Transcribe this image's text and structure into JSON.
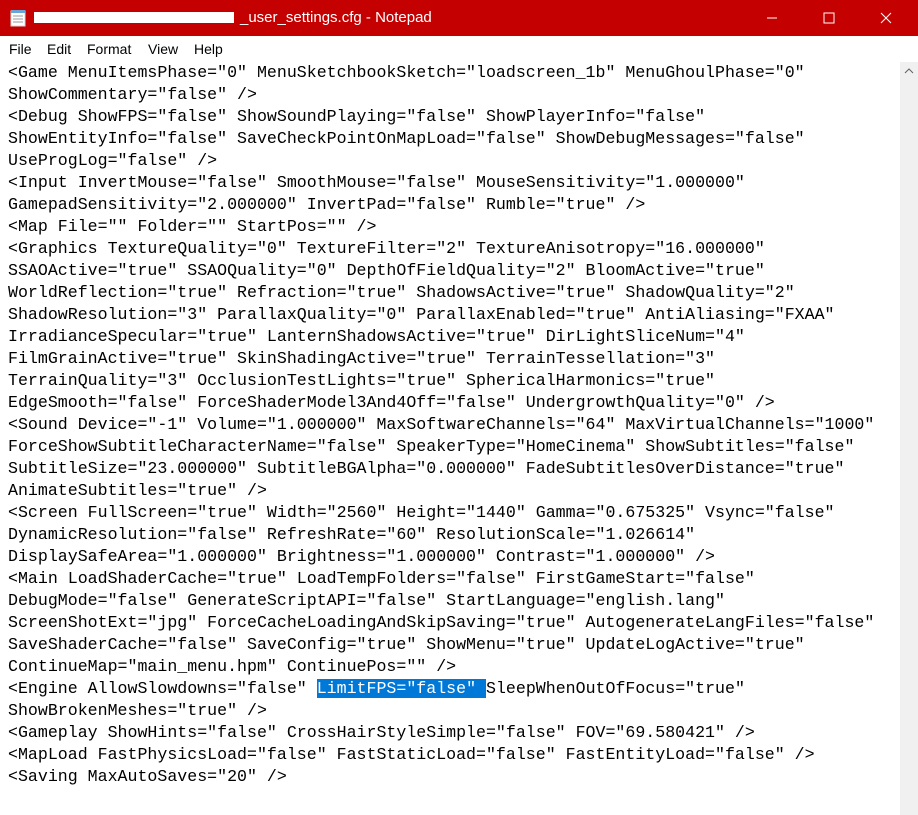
{
  "window": {
    "title": "_user_settings.cfg - Notepad",
    "minimize_glyph": "—",
    "maximize_glyph": "☐",
    "close_glyph": "✕"
  },
  "menu": {
    "file": "File",
    "edit": "Edit",
    "format": "Format",
    "view": "View",
    "help": "Help"
  },
  "lines": [
    "<Game MenuItemsPhase=\"0\" MenuSketchbookSketch=\"loadscreen_1b\" MenuGhoulPhase=\"0\"",
    "ShowCommentary=\"false\" />",
    "<Debug ShowFPS=\"false\" ShowSoundPlaying=\"false\" ShowPlayerInfo=\"false\"",
    "ShowEntityInfo=\"false\" SaveCheckPointOnMapLoad=\"false\" ShowDebugMessages=\"false\"",
    "UseProgLog=\"false\" />",
    "<Input InvertMouse=\"false\" SmoothMouse=\"false\" MouseSensitivity=\"1.000000\"",
    "GamepadSensitivity=\"2.000000\" InvertPad=\"false\" Rumble=\"true\" />",
    "<Map File=\"\" Folder=\"\" StartPos=\"\" />",
    "<Graphics TextureQuality=\"0\" TextureFilter=\"2\" TextureAnisotropy=\"16.000000\"",
    "SSAOActive=\"true\" SSAOQuality=\"0\" DepthOfFieldQuality=\"2\" BloomActive=\"true\"",
    "WorldReflection=\"true\" Refraction=\"true\" ShadowsActive=\"true\" ShadowQuality=\"2\"",
    "ShadowResolution=\"3\" ParallaxQuality=\"0\" ParallaxEnabled=\"true\" AntiAliasing=\"FXAA\"",
    "IrradianceSpecular=\"true\" LanternShadowsActive=\"true\" DirLightSliceNum=\"4\"",
    "FilmGrainActive=\"true\" SkinShadingActive=\"true\" TerrainTessellation=\"3\"",
    "TerrainQuality=\"3\" OcclusionTestLights=\"true\" SphericalHarmonics=\"true\"",
    "EdgeSmooth=\"false\" ForceShaderModel3And4Off=\"false\" UndergrowthQuality=\"0\" />",
    "<Sound Device=\"-1\" Volume=\"1.000000\" MaxSoftwareChannels=\"64\" MaxVirtualChannels=\"1000\"",
    "ForceShowSubtitleCharacterName=\"false\" SpeakerType=\"HomeCinema\" ShowSubtitles=\"false\"",
    "SubtitleSize=\"23.000000\" SubtitleBGAlpha=\"0.000000\" FadeSubtitlesOverDistance=\"true\"",
    "AnimateSubtitles=\"true\" />",
    "<Screen FullScreen=\"true\" Width=\"2560\" Height=\"1440\" Gamma=\"0.675325\" Vsync=\"false\"",
    "DynamicResolution=\"false\" RefreshRate=\"60\" ResolutionScale=\"1.026614\"",
    "DisplaySafeArea=\"1.000000\" Brightness=\"1.000000\" Contrast=\"1.000000\" />",
    "<Main LoadShaderCache=\"true\" LoadTempFolders=\"false\" FirstGameStart=\"false\"",
    "DebugMode=\"false\" GenerateScriptAPI=\"false\" StartLanguage=\"english.lang\"",
    "ScreenShotExt=\"jpg\" ForceCacheLoadingAndSkipSaving=\"true\" AutogenerateLangFiles=\"false\"",
    "SaveShaderCache=\"false\" SaveConfig=\"true\" ShowMenu=\"true\" UpdateLogActive=\"true\"",
    "ContinueMap=\"main_menu.hpm\" ContinuePos=\"\" />"
  ],
  "engine_line": {
    "before": "<Engine AllowSlowdowns=\"false\" ",
    "selected": "LimitFPS=\"false\" ",
    "after": "SleepWhenOutOfFocus=\"true\""
  },
  "lines_after": [
    "ShowBrokenMeshes=\"true\" />",
    "<Gameplay ShowHints=\"false\" CrossHairStyleSimple=\"false\" FOV=\"69.580421\" />",
    "<MapLoad FastPhysicsLoad=\"false\" FastStaticLoad=\"false\" FastEntityLoad=\"false\" />",
    "<Saving MaxAutoSaves=\"20\" />"
  ],
  "colors": {
    "titlebar": "#c40000",
    "selection": "#0078d7"
  }
}
